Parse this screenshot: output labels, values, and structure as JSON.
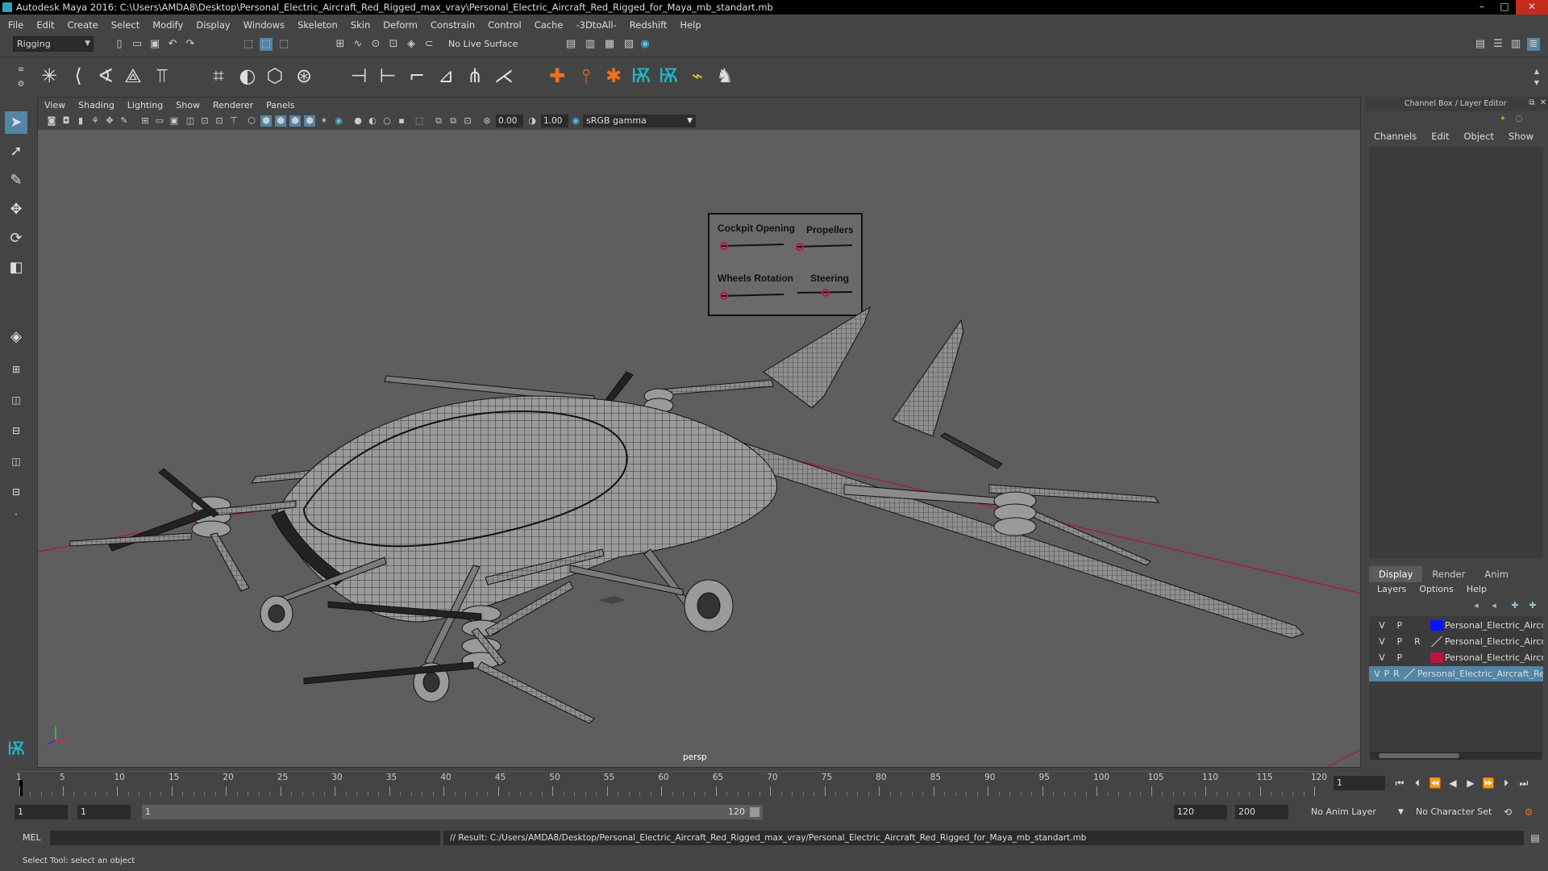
{
  "window": {
    "title": "Autodesk Maya 2016: C:\\Users\\AMDA8\\Desktop\\Personal_Electric_Aircraft_Red_Rigged_max_vray\\Personal_Electric_Aircraft_Red_Rigged_for_Maya_mb_standart.mb",
    "minimize": "–",
    "maximize": "□",
    "close": "✕"
  },
  "menubar": [
    "File",
    "Edit",
    "Create",
    "Select",
    "Modify",
    "Display",
    "Windows",
    "Skeleton",
    "Skin",
    "Deform",
    "Constrain",
    "Control",
    "Cache",
    "-3DtoAll-",
    "Redshift",
    "Help"
  ],
  "statusline": {
    "mode": "Rigging",
    "live_surface": "No Live Surface"
  },
  "viewport": {
    "menus": [
      "View",
      "Shading",
      "Lighting",
      "Show",
      "Renderer",
      "Panels"
    ],
    "exposure": "0.00",
    "gamma": "1.00",
    "color_space": "sRGB gamma",
    "camera_label": "persp",
    "controls": {
      "cockpit": "Cockpit Opening",
      "propellers": "Propellers",
      "wheels": "Wheels Rotation",
      "steering": "Steering"
    }
  },
  "channelbox": {
    "title": "Channel Box / Layer Editor",
    "menus": [
      "Channels",
      "Edit",
      "Object",
      "Show"
    ]
  },
  "layer_editor": {
    "tabs": [
      "Display",
      "Render",
      "Anim"
    ],
    "active_tab": "Display",
    "menus": [
      "Layers",
      "Options",
      "Help"
    ],
    "layers": [
      {
        "v": "V",
        "p": "P",
        "r": "",
        "color": "#0a14ff",
        "name": "Personal_Electric_Aircraft",
        "selected": false
      },
      {
        "v": "V",
        "p": "P",
        "r": "R",
        "color": "",
        "name": "Personal_Electric_Aircraft",
        "selected": false
      },
      {
        "v": "V",
        "p": "P",
        "r": "",
        "color": "#c0143c",
        "name": "Personal_Electric_Aircraft",
        "selected": false
      },
      {
        "v": "V",
        "p": "P",
        "r": "R",
        "color": "",
        "name": "Personal_Electric_Aircraft_Red",
        "selected": true
      }
    ]
  },
  "timeslider": {
    "ticks": [
      "1",
      "5",
      "10",
      "15",
      "20",
      "25",
      "30",
      "35",
      "40",
      "45",
      "50",
      "55",
      "60",
      "65",
      "70",
      "75",
      "80",
      "85",
      "90",
      "95",
      "100",
      "105",
      "110",
      "115",
      "120"
    ],
    "current_frame": "1"
  },
  "rangeslider": {
    "start": "1",
    "playback_start": "1",
    "range_lo": "1",
    "range_hi": "120",
    "playback_end": "120",
    "end": "200",
    "anim_layer": "No Anim Layer",
    "char_set": "No Character Set"
  },
  "cmdline": {
    "label": "MEL",
    "result": "// Result: C:/Users/AMDA8/Desktop/Personal_Electric_Aircraft_Red_Rigged_max_vray/Personal_Electric_Aircraft_Red_Rigged_for_Maya_mb_standart.mb"
  },
  "helpline": "Select Tool: select an object",
  "colors": {
    "accent": "#5285a6",
    "axis_red": "#b4143c"
  }
}
